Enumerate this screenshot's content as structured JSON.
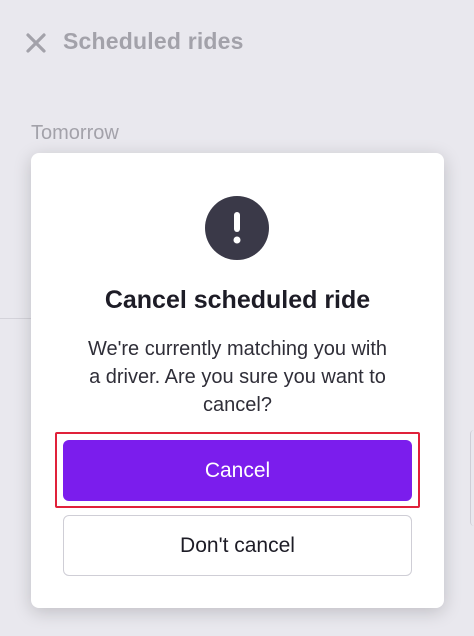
{
  "header": {
    "close_icon": "close-icon",
    "title": "Scheduled rides"
  },
  "list": {
    "section_label": "Tomorrow"
  },
  "dialog": {
    "icon": "exclamation-icon",
    "title": "Cancel scheduled ride",
    "message": "We're currently matching you with a driver. Are you sure you want to cancel?",
    "primary_label": "Cancel",
    "secondary_label": "Don't cancel"
  },
  "colors": {
    "primary_button": "#7b1ded",
    "highlight_outline": "#e0213a",
    "alert_icon_bg": "#3a3948",
    "overlay_bg": "#e9e8ee"
  }
}
